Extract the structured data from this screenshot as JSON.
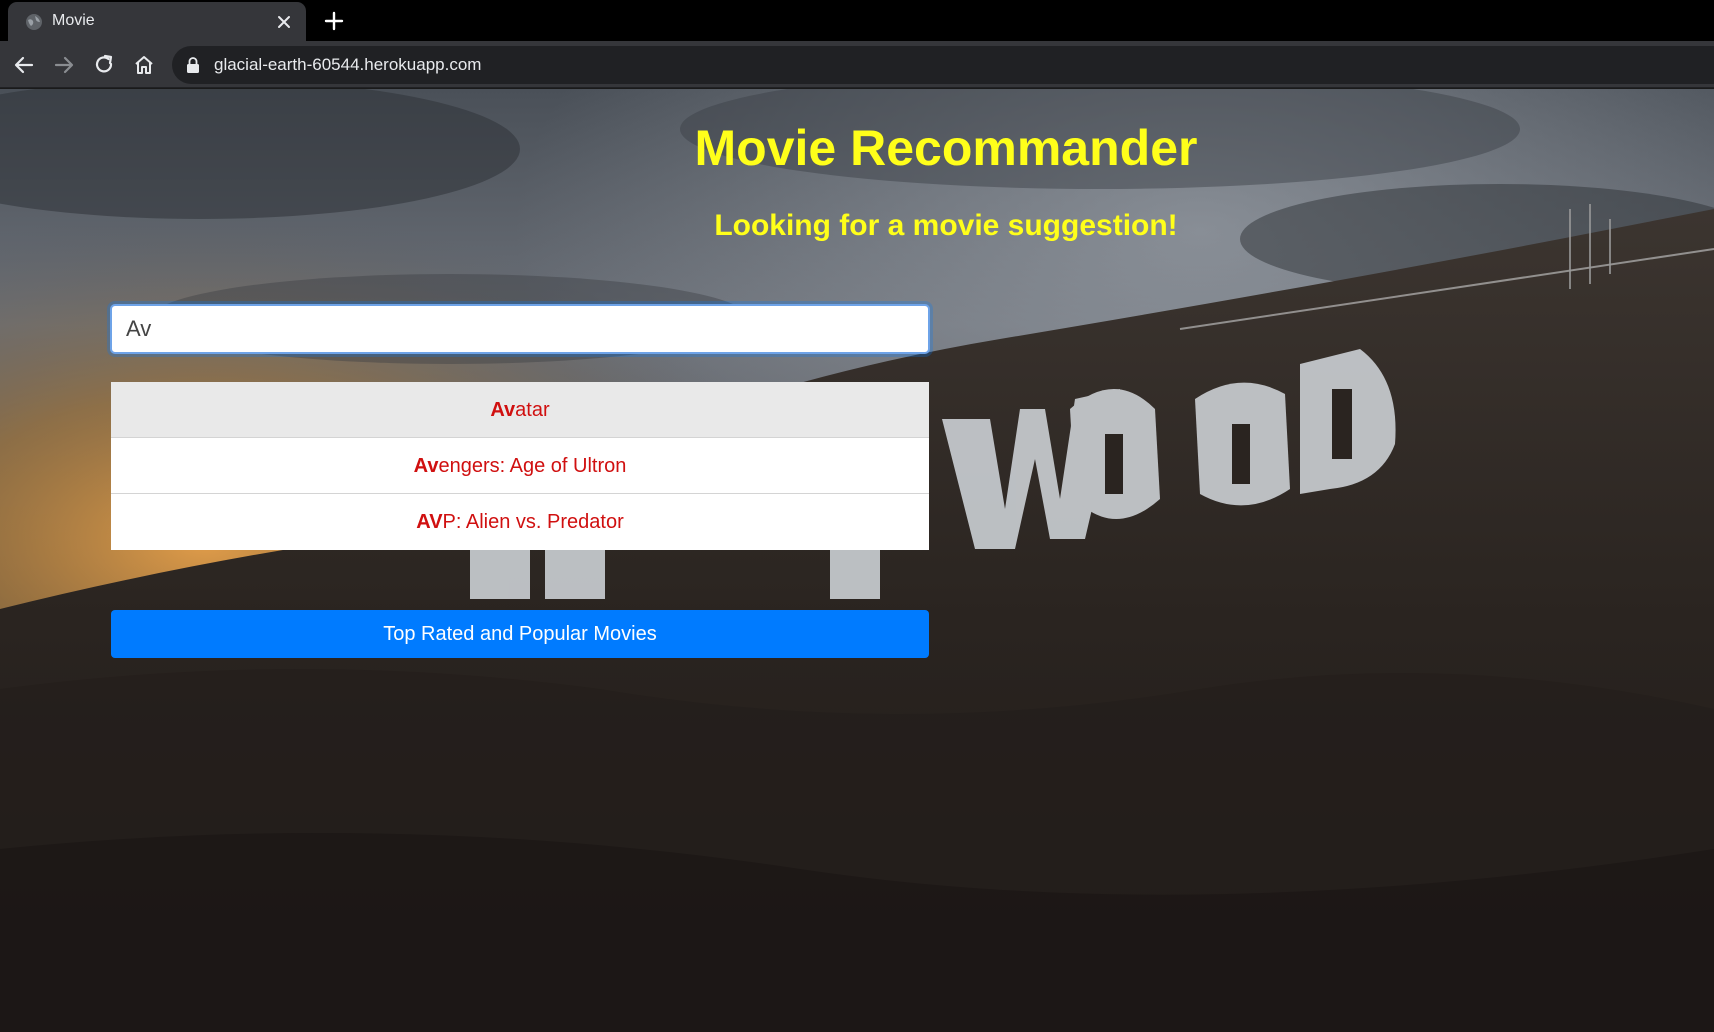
{
  "browser": {
    "tab_title": "Movie",
    "url": "glacial-earth-60544.herokuapp.com"
  },
  "page": {
    "title": "Movie Recommander",
    "subtitle": "Looking for a movie suggestion!",
    "search": {
      "value": "Av"
    },
    "suggestions": [
      {
        "match": "Av",
        "rest": "atar",
        "active": true
      },
      {
        "match": "Av",
        "rest": "engers: Age of Ultron",
        "active": false
      },
      {
        "match": "AV",
        "rest": "P: Alien vs. Predator",
        "active": false
      }
    ],
    "top_button_label": "Top Rated and Popular Movies",
    "background_image": "hollywood-sign-photo"
  },
  "colors": {
    "title": "#ffff1a",
    "suggestion_text": "#d01010",
    "button": "#007bff",
    "input_focus": "#6ea3e8"
  }
}
